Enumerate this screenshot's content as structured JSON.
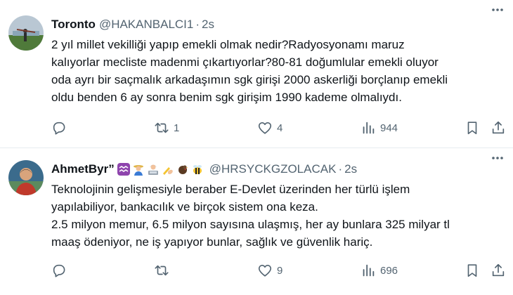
{
  "tweets": [
    {
      "name": "Toronto",
      "handle": "@HAKANBALCI1",
      "time": "2s",
      "text": "2 yıl millet vekilliği yapıp emekli olmak nedir?Radyosyonamı maruz\nkalıyorlar mecliste madenmi çıkartıyorlar?80-81 doğumlular emekli oluyor\noda ayrı bir saçmalık arkadaşımın sgk girişi 2000 askerliği borçlanıp emekli\noldu benden 6 ay sonra benim sgk girişim 1990 kademe olmalıydı.",
      "replies": "",
      "retweets": "1",
      "likes": "4",
      "views": "944",
      "avatar_colors": {
        "sky": "#b9c7d3",
        "field": "#4f7a3a"
      }
    },
    {
      "name": "AhmetByr”",
      "emoji_icons": [
        "aquarius-icon",
        "farmer-icon",
        "technologist-icon",
        "writing-hand-icon",
        "turkey-icon",
        "bee-icon"
      ],
      "handle": "@HRSYCKGZOLACAK",
      "time": "2s",
      "text": "Teknolojinin gelişmesiyle beraber E-Devlet üzerinden her türlü işlem\nyapılabiliyor, bankacılık ve birçok sistem ona keza.\n2.5 milyon memur, 6.5 milyon sayısına ulaşmış, her ay bunlara 325 milyar tl\nmaaş ödeniyor, ne iş yapıyor bunlar, sağlık ve güvenlik hariç.",
      "replies": "",
      "retweets": "",
      "likes": "9",
      "views": "696",
      "avatar_colors": {
        "bg": "#3b6b8c",
        "shirt": "#c0392b"
      }
    }
  ],
  "dot": "·",
  "colors": {
    "text": "#0f1419",
    "secondary": "#536471",
    "divider": "#e6ecf0"
  }
}
